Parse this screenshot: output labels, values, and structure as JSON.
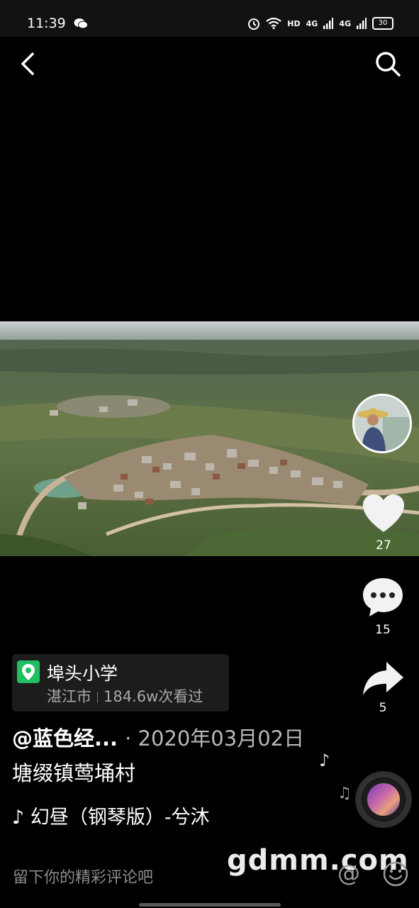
{
  "status_bar": {
    "time": "11:39",
    "hd_label": "HD",
    "signal1": "4G",
    "signal2": "4G",
    "battery": "30"
  },
  "location": {
    "title": "埠头小学",
    "city": "湛江市",
    "views": "184.6w次看过"
  },
  "author": {
    "handle": "@蓝色经...",
    "date": "· 2020年03月02日"
  },
  "caption": "塘缀镇莺埇村",
  "music": "♪ 幻昼（钢琴版）-兮沐",
  "actions": {
    "likes": "27",
    "comments": "15",
    "shares": "5"
  },
  "comment": {
    "placeholder": "留下你的精彩评论吧"
  },
  "watermark": "gdmm.com",
  "colors": {
    "background": "#000000",
    "location_pin": "#1fbf63",
    "secondary_text": "#a9a9a9"
  }
}
